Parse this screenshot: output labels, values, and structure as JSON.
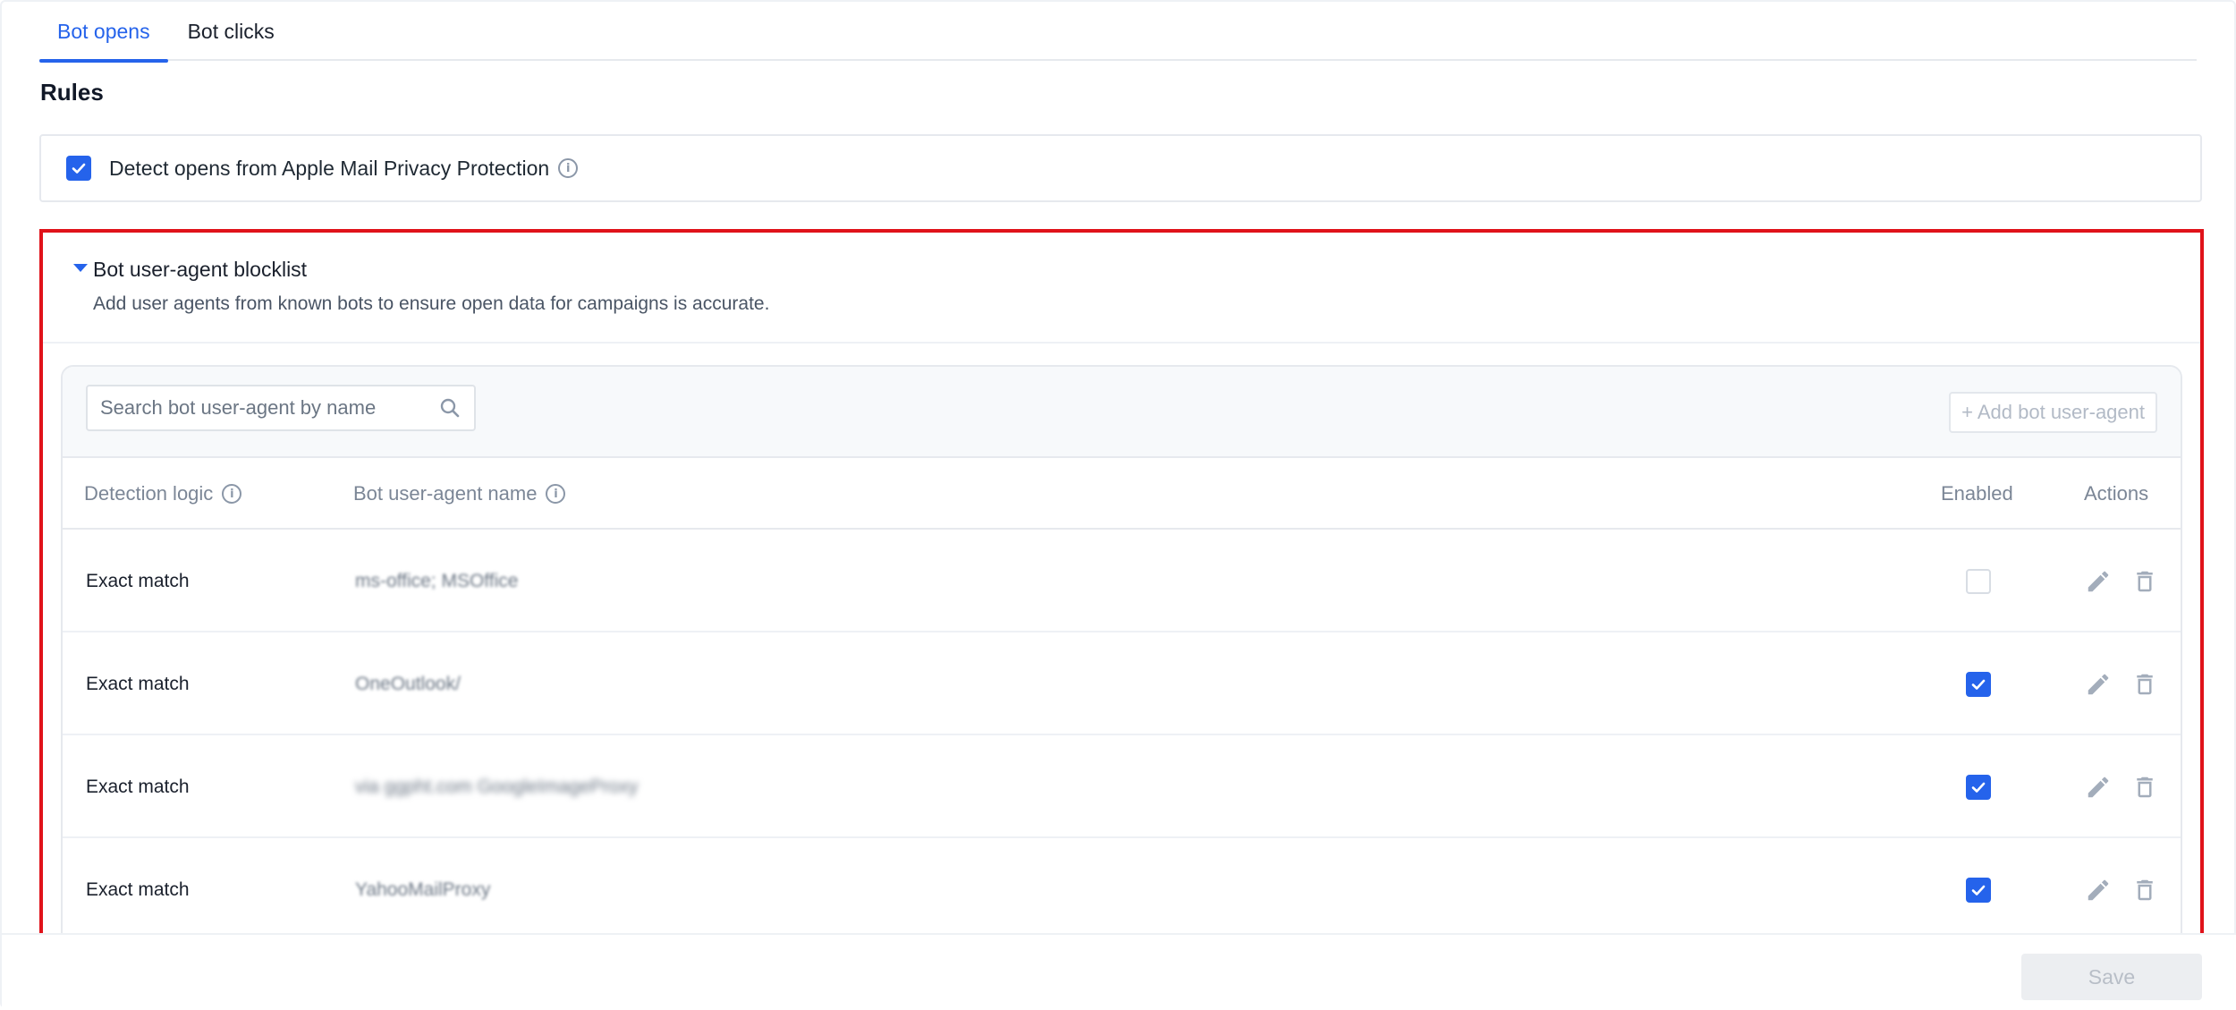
{
  "tabs": [
    {
      "label": "Bot opens",
      "active": true
    },
    {
      "label": "Bot clicks",
      "active": false
    }
  ],
  "rules": {
    "title": "Rules",
    "apple_privacy": {
      "label": "Detect opens from Apple Mail Privacy Protection",
      "checked": true
    }
  },
  "blocklist": {
    "title": "Bot user-agent blocklist",
    "description": "Add user agents from known bots to ensure open data for campaigns is accurate.",
    "search_placeholder": "Search bot user-agent by name",
    "add_label": "+ Add bot user-agent",
    "columns": {
      "logic": "Detection logic",
      "name": "Bot user-agent name",
      "enabled": "Enabled",
      "actions": "Actions"
    },
    "rows": [
      {
        "logic": "Exact match",
        "name": "ms-office; MSOffice",
        "enabled": false
      },
      {
        "logic": "Exact match",
        "name": "OneOutlook/",
        "enabled": true
      },
      {
        "logic": "Exact match",
        "name": "via ggpht.com GoogleImageProxy",
        "enabled": true
      },
      {
        "logic": "Exact match",
        "name": "YahooMailProxy",
        "enabled": true
      }
    ]
  },
  "footer": {
    "save_label": "Save"
  },
  "colors": {
    "accent": "#2563eb",
    "highlight": "#e0121a"
  }
}
